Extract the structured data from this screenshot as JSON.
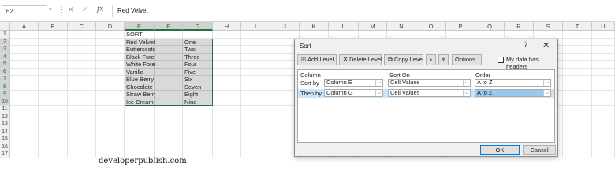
{
  "formula_bar": {
    "name_box": "E2",
    "name_box_arrow": "▾",
    "dots": "⋮",
    "cancel": "✕",
    "enter": "✓",
    "fx": "fx",
    "value": "Red Velvet"
  },
  "columns": [
    "A",
    "B",
    "C",
    "D",
    "E",
    "F",
    "G",
    "H",
    "I",
    "J",
    "K",
    "L",
    "M",
    "N",
    "O",
    "P",
    "Q",
    "R",
    "S",
    "T",
    "U"
  ],
  "rows": [
    "1",
    "2",
    "3",
    "4",
    "5",
    "6",
    "7",
    "8",
    "9",
    "10",
    "11",
    "12",
    "13",
    "14",
    "15",
    "16",
    "17"
  ],
  "sheet": {
    "header_cell": "SORT",
    "items": [
      {
        "name": "Red Velvet",
        "num": "One"
      },
      {
        "name": "Butterscotch",
        "num": "Two"
      },
      {
        "name": "Black Forest",
        "num": "Three"
      },
      {
        "name": "White Forest",
        "num": "Four"
      },
      {
        "name": "Vanilla",
        "num": "Five"
      },
      {
        "name": "Blue Berry",
        "num": "Six"
      },
      {
        "name": "Chocolate",
        "num": "Seven"
      },
      {
        "name": "Straw Berry",
        "num": "Eight"
      },
      {
        "name": "Ice Cream",
        "num": "Nine"
      }
    ]
  },
  "watermark": "developerpublish.com",
  "dialog": {
    "title": "Sort",
    "help": "?",
    "close": "✕",
    "toolbar": {
      "add_level": "Add Level",
      "delete_level": "Delete Level",
      "copy_level": "Copy Level",
      "move_up": "▲",
      "move_down": "▼",
      "options": "Options...",
      "has_headers": "My data has headers"
    },
    "list_headers": {
      "column": "Column",
      "sort_on": "Sort On",
      "order": "Order"
    },
    "levels": [
      {
        "label": "Sort by",
        "column": "Column E",
        "sort_on": "Cell Values",
        "order": "A to Z"
      },
      {
        "label": "Then by",
        "column": "Column G",
        "sort_on": "Cell Values",
        "order": "A to Z"
      }
    ],
    "ok": "OK",
    "cancel": "Cancel"
  },
  "colors": {
    "accent": "#217346",
    "selection": "#d9d9d9",
    "row_highlight": "#cde6f7"
  }
}
